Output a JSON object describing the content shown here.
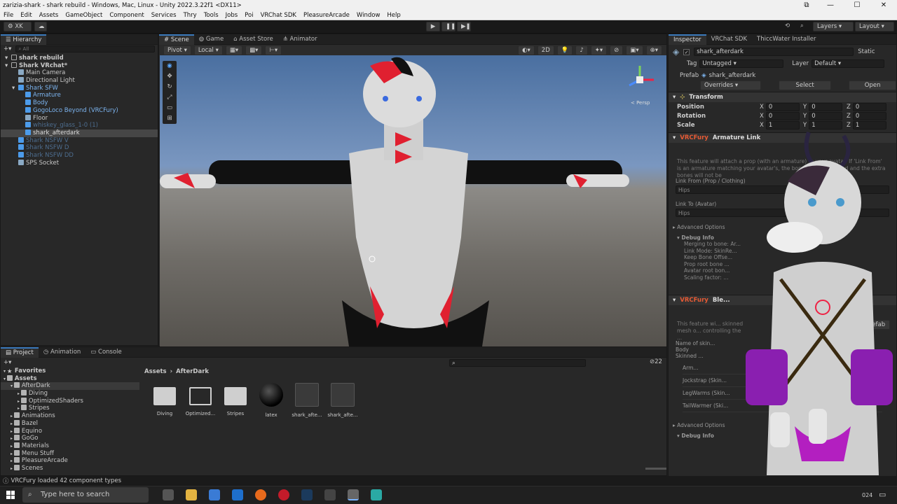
{
  "window": {
    "title": "zarizia-shark - shark rebuild - Windows, Mac, Linux - Unity 2022.3.22f1 <DX11>"
  },
  "menu": [
    "File",
    "Edit",
    "Assets",
    "GameObject",
    "Component",
    "Services",
    "Thry",
    "Tools",
    "Jobs",
    "Poi",
    "VRChat SDK",
    "PleasureArcade",
    "Window",
    "Help"
  ],
  "toolbar": {
    "account": "XK",
    "layers": "Layers",
    "layout": "Layout"
  },
  "hierarchy": {
    "tab": "Hierarchy",
    "search_placeholder": "All",
    "items": [
      {
        "label": "shark rebuild",
        "indent": 0,
        "type": "scene"
      },
      {
        "label": "Shark VRchat*",
        "indent": 0,
        "type": "scene"
      },
      {
        "label": "Main Camera",
        "indent": 1,
        "type": "go"
      },
      {
        "label": "Directional Light",
        "indent": 1,
        "type": "go"
      },
      {
        "label": "Shark SFW",
        "indent": 1,
        "type": "prefab"
      },
      {
        "label": "Armature",
        "indent": 2,
        "type": "prefab"
      },
      {
        "label": "Body",
        "indent": 2,
        "type": "prefab"
      },
      {
        "label": "GogoLoco Beyond (VRCFury)",
        "indent": 2,
        "type": "prefab"
      },
      {
        "label": "Floor",
        "indent": 2,
        "type": "go"
      },
      {
        "label": "whiskey_glass_1-0 (1)",
        "indent": 2,
        "type": "disabled"
      },
      {
        "label": "shark_afterdark",
        "indent": 2,
        "type": "selected"
      },
      {
        "label": "Shark NSFW V",
        "indent": 1,
        "type": "disabled"
      },
      {
        "label": "Shark NSFW D",
        "indent": 1,
        "type": "disabled"
      },
      {
        "label": "Shark NSFW DD",
        "indent": 1,
        "type": "disabled"
      },
      {
        "label": "SPS Socket",
        "indent": 1,
        "type": "go"
      }
    ]
  },
  "scene_tabs": [
    "Scene",
    "Game",
    "Asset Store",
    "Animator"
  ],
  "scene_toolbar": {
    "pivot": "Pivot",
    "local": "Local",
    "mode2d": "2D",
    "persp": "< Persp"
  },
  "inspector": {
    "tabs": [
      "Inspector",
      "VRChat SDK",
      "ThiccWater Installer"
    ],
    "object_name": "shark_afterdark",
    "static_label": "Static",
    "tag_label": "Tag",
    "tag_value": "Untagged",
    "layer_label": "Layer",
    "layer_value": "Default",
    "prefab_label": "Prefab",
    "prefab_value": "shark_afterdark",
    "overrides": "Overrides",
    "select": "Select",
    "open": "Open",
    "transform": {
      "title": "Transform",
      "rows": [
        {
          "label": "Position",
          "x": "0",
          "y": "0",
          "z": "0"
        },
        {
          "label": "Rotation",
          "x": "0",
          "y": "0",
          "z": "0"
        },
        {
          "label": "Scale",
          "x": "1",
          "y": "1",
          "z": "1"
        }
      ]
    },
    "vrcfury1": {
      "badge": "VRCFury",
      "title": "Armature Link",
      "desc": "This feature will attach a prop (with an armature) to your avatar. If 'Link From' is an armature matching your avatar's, the bones will be merged and the extra bones will not be",
      "link_from_label": "Link From (Prop / Clothing)",
      "link_from_value": "Hips",
      "link_to_label": "Link To (Avatar)",
      "link_to_value": "Hips",
      "advanced": "Advanced Options",
      "debug": "Debug Info",
      "debug_lines": [
        "Merging to bone: Ar...",
        "Link Mode: SkinRe...",
        "Keep Bone Offse...",
        "Prop root bone ...",
        "Avatar root bon...",
        "Scaling factor: ..."
      ]
    },
    "vrcfury2": {
      "badge": "VRCFury",
      "title": "Ble...",
      "desc": "This feature wi... skinned mesh o... controlling the ...",
      "name_label": "Name of skin...",
      "body": "Body",
      "skinned": "Skinned ...",
      "items": [
        "Arm...",
        "Jockstrap (Skin...",
        "LegWarms (Skin...",
        "TailWarmer (Ski..."
      ],
      "advanced": "Advanced Options",
      "debug": "Debug Info",
      "prefab_btn": "Prefab"
    }
  },
  "project": {
    "tabs": [
      "Project",
      "Animation",
      "Console"
    ],
    "tree": [
      {
        "label": "Favorites",
        "indent": 0,
        "bold": true
      },
      {
        "label": "Assets",
        "indent": 0,
        "bold": true
      },
      {
        "label": "AfterDark",
        "indent": 1
      },
      {
        "label": "Diving",
        "indent": 2
      },
      {
        "label": "OptimizedShaders",
        "indent": 2
      },
      {
        "label": "Stripes",
        "indent": 2
      },
      {
        "label": "Animations",
        "indent": 1
      },
      {
        "label": "Bazel",
        "indent": 1
      },
      {
        "label": "Equino",
        "indent": 1
      },
      {
        "label": "GoGo",
        "indent": 1
      },
      {
        "label": "Materials",
        "indent": 1
      },
      {
        "label": "Menu Stuff",
        "indent": 1
      },
      {
        "label": "PleasureArcade",
        "indent": 1
      },
      {
        "label": "Scenes",
        "indent": 1
      }
    ],
    "breadcrumb": [
      "Assets",
      "AfterDark"
    ],
    "count": "22",
    "assets": [
      "Diving",
      "Optimized...",
      "Stripes",
      "latex",
      "shark_afte...",
      "shark_afte..."
    ]
  },
  "status": "VRCFury loaded 42 component types",
  "taskbar": {
    "search_placeholder": "Type here to search",
    "date": "024"
  }
}
